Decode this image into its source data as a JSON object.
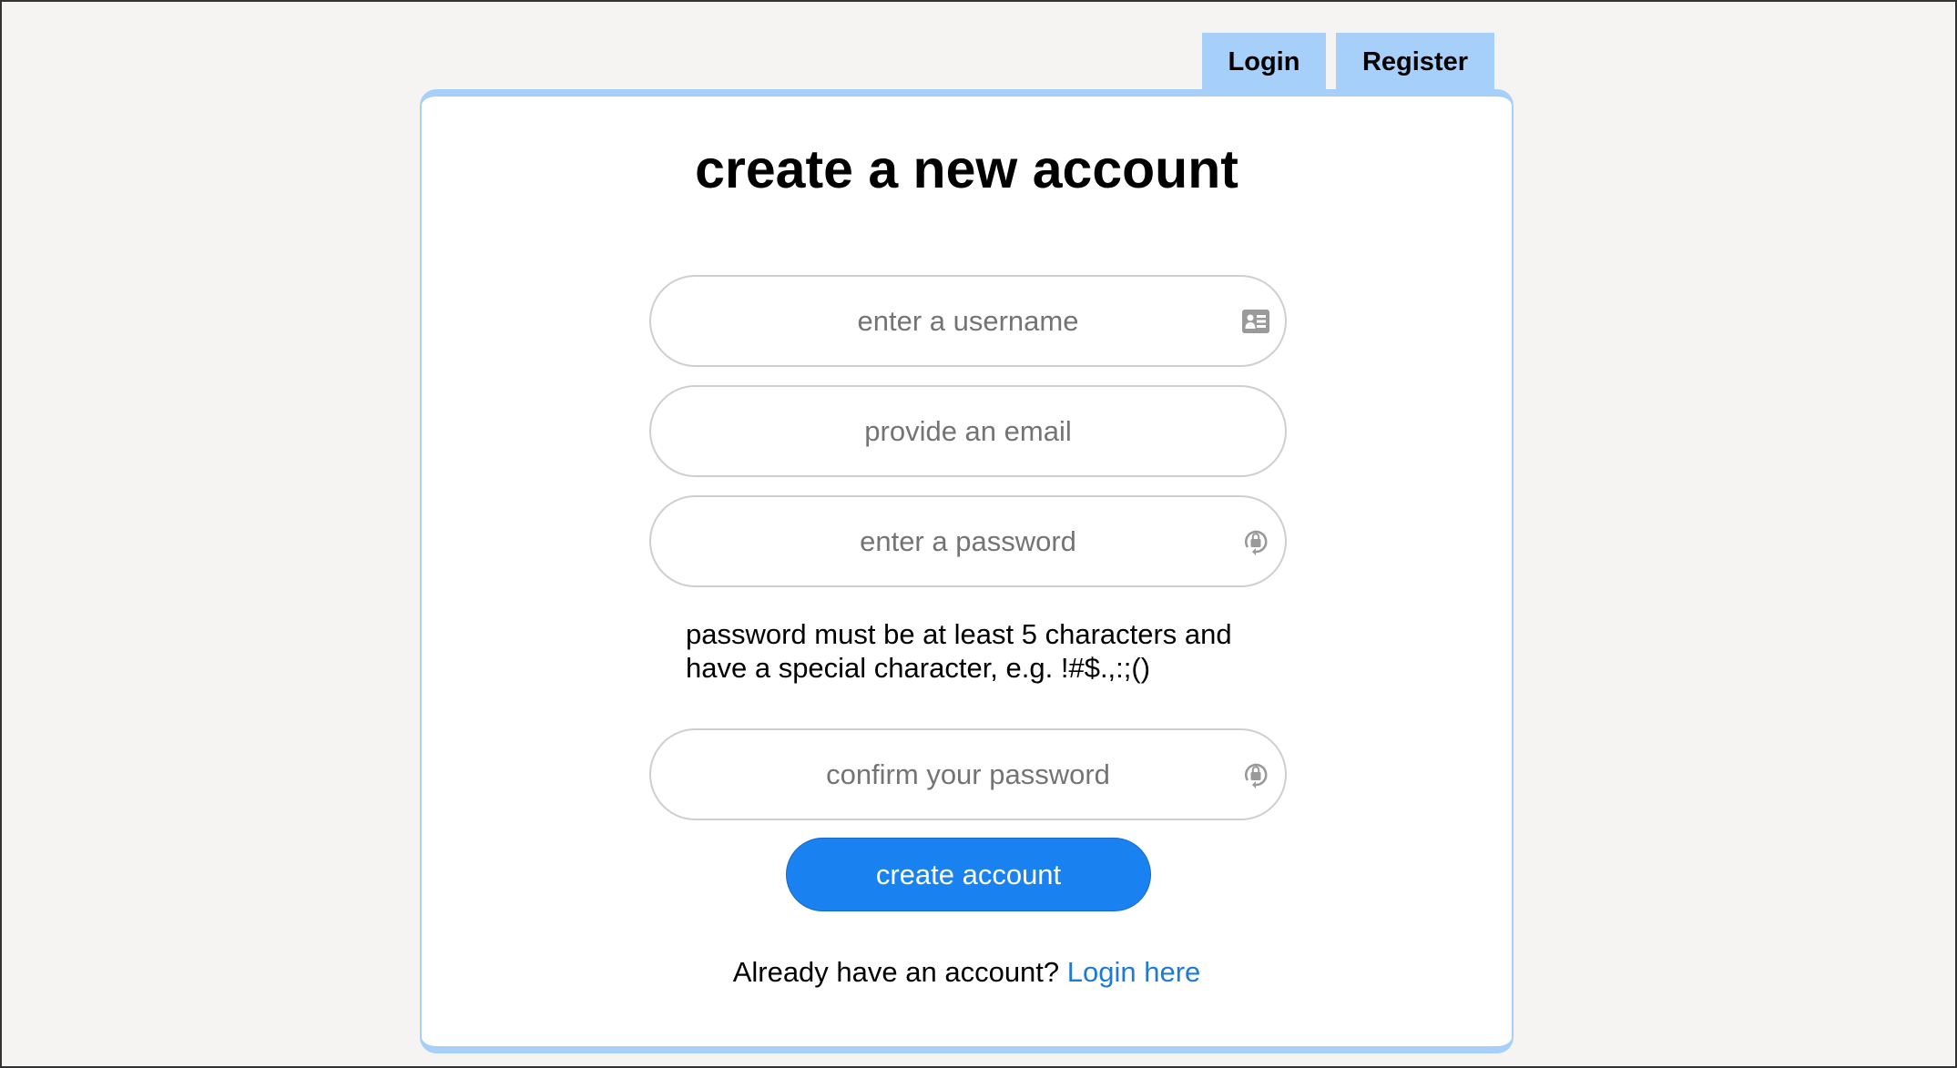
{
  "tabs": {
    "login": "Login",
    "register": "Register"
  },
  "form": {
    "title": "create a new account",
    "username": {
      "placeholder": "enter a username",
      "value": "",
      "icon": "id-card-icon"
    },
    "email": {
      "placeholder": "provide an email",
      "value": ""
    },
    "password": {
      "placeholder": "enter a password",
      "value": "",
      "icon": "lock-reset-icon"
    },
    "password_hint": "password must be at least 5 characters and have a special character, e.g. !#$.,:;()",
    "confirm_password": {
      "placeholder": "confirm your password",
      "value": "",
      "icon": "lock-reset-icon"
    },
    "submit_label": "create account"
  },
  "footer": {
    "prompt": "Already have an account?",
    "link_label": "Login here"
  },
  "colors": {
    "accent": "#1a82f0",
    "tab_bg": "#a6cffa",
    "link": "#1f7ad6",
    "page_bg": "#f5f4f2"
  }
}
